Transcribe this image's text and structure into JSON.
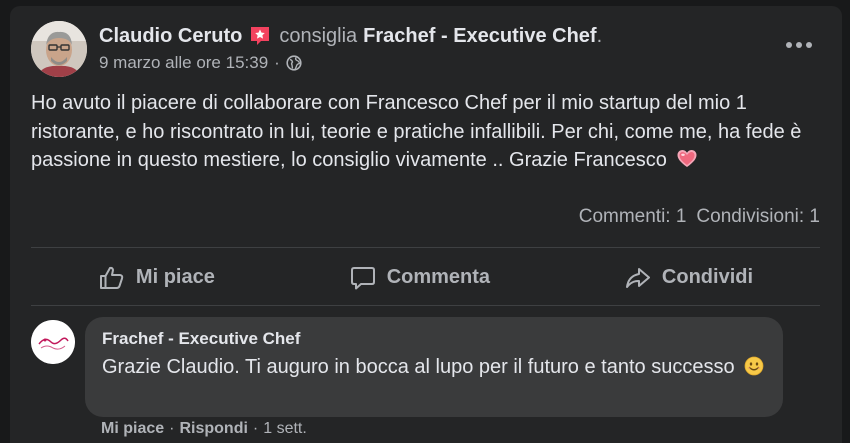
{
  "post": {
    "author": "Claudio Ceruto",
    "action": "consiglia",
    "page": "Frachef - Executive Chef",
    "period": ".",
    "timestamp": "9 marzo alle ore 15:39",
    "separator": "·",
    "audience_icon": "globe-icon",
    "badge_icon": "recommendation-star-icon",
    "text": "Ho avuto il piacere di collaborare con Francesco Chef per il mio startup del mio 1 ristorante, e ho riscontrato in lui, teorie e pratiche infallibili. Per chi, come me, ha fede è passione in questo mestiere, lo consiglio vivamente .. Grazie Francesco",
    "text_emoji": "heart-emoji",
    "comments_count": "Commenti: 1",
    "shares_count": "Condivisioni: 1"
  },
  "actions": {
    "like": "Mi piace",
    "comment": "Commenta",
    "share": "Condividi"
  },
  "comment": {
    "author": "Frachef - Executive Chef",
    "text": "Grazie Claudio. Ti auguro in bocca al lupo per il futuro e tanto successo",
    "text_emoji": "smiling-face-emoji",
    "like": "Mi piace",
    "reply": "Rispondi",
    "time": "1 sett.",
    "sep": "·"
  },
  "colors": {
    "background": "#18191a",
    "card": "#242526",
    "bubble": "#3a3b3c",
    "primary_text": "#e4e6eb",
    "secondary_text": "#b0b3b8",
    "badge": "#f3425f"
  }
}
